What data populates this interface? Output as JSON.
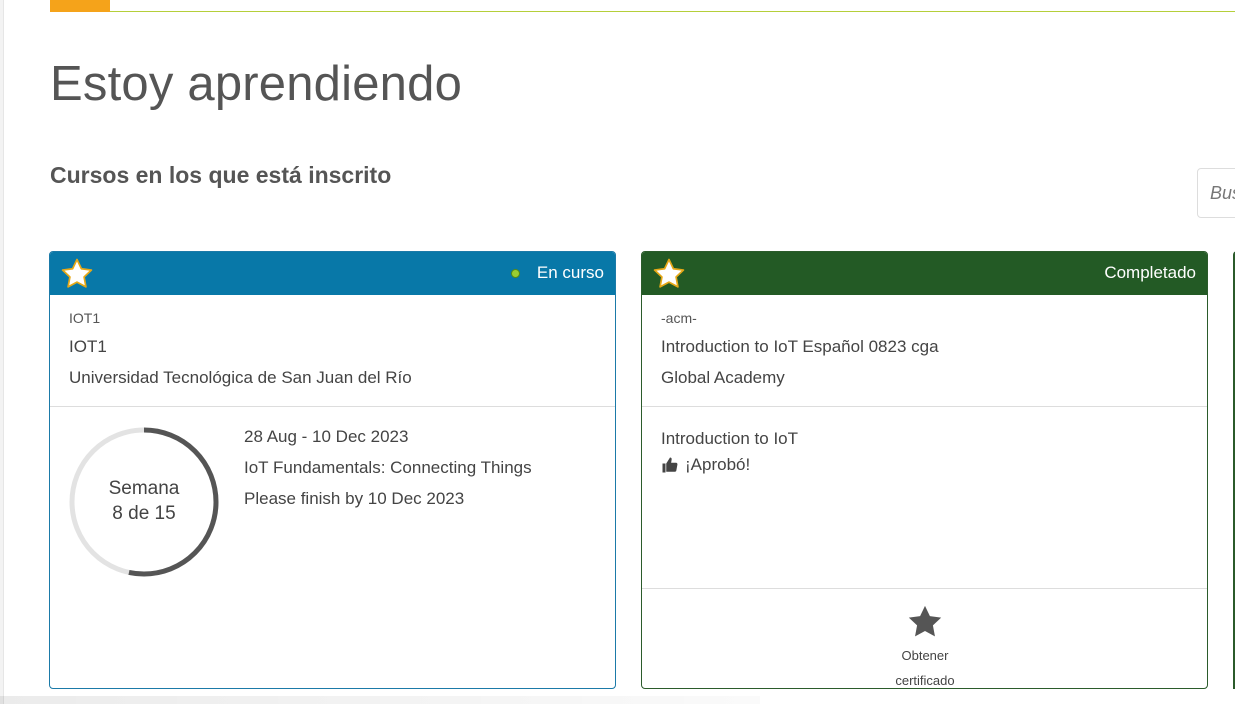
{
  "header": {
    "title": "Estoy aprendiendo",
    "subtitle": "Cursos en los que está inscrito"
  },
  "search": {
    "placeholder": "Bus"
  },
  "colors": {
    "in_progress_header": "#0878a8",
    "completed_header": "#235a25",
    "accent_orange": "#f5a31a",
    "accent_lime": "#b5cf3a",
    "star_fill": "#ffffff",
    "star_outline": "#e6a817"
  },
  "cards": [
    {
      "status": "En curso",
      "status_icon": "green-dot-icon",
      "favorite_icon": "star-icon",
      "code": "IOT1",
      "name": "IOT1",
      "org": "Universidad Tecnológica de San Juan del Río",
      "progress": {
        "label_line1": "Semana",
        "label_line2": "8 de 15",
        "current": 8,
        "total": 15
      },
      "dates": "28 Aug - 10 Dec 2023",
      "session_title": "IoT Fundamentals: Connecting Things",
      "deadline": "Please finish by 10 Dec 2023"
    },
    {
      "status": "Completado",
      "favorite_icon": "star-icon",
      "code": "-acm-",
      "name": "Introduction to IoT Español 0823 cga",
      "org": "Global Academy",
      "course_title": "Introduction to IoT",
      "passed_icon": "thumbs-up-icon",
      "passed_text": "¡Aprobó!",
      "certificate_icon": "star-icon",
      "certificate_label_line1": "Obtener",
      "certificate_label_line2": "certificado"
    }
  ]
}
